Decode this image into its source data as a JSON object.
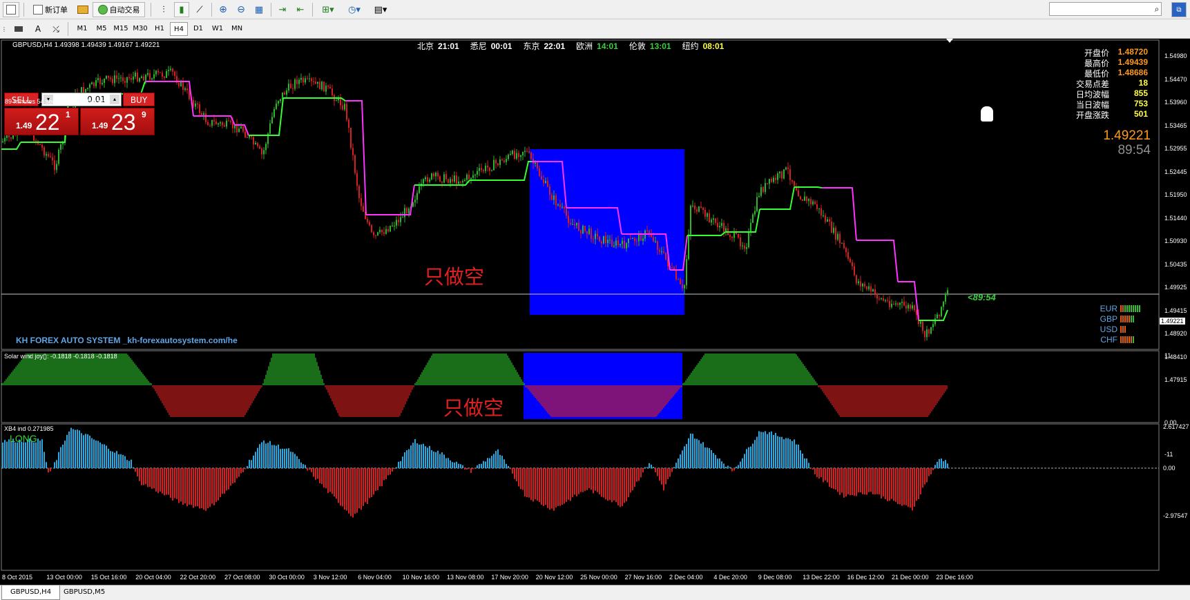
{
  "toolbar": {
    "new_order_label": "新订单",
    "auto_trading_label": "自动交易"
  },
  "timeframes": [
    "M1",
    "M5",
    "M15",
    "M30",
    "H1",
    "H4",
    "D1",
    "W1",
    "MN"
  ],
  "active_timeframe": "H4",
  "chart": {
    "header_text": "GBPUSD,H4  1.49398 1.49439 1.49167 1.49221",
    "sessions": [
      {
        "city": "北京",
        "time": "21:01",
        "color": "#ffffff"
      },
      {
        "city": "悉尼",
        "time": "00:01",
        "color": "#ffffff"
      },
      {
        "city": "东京",
        "time": "22:01",
        "color": "#ffffff"
      },
      {
        "city": "欧洲",
        "time": "14:01",
        "color": "#3ad23a"
      },
      {
        "city": "伦敦",
        "time": "13:01",
        "color": "#3ad23a"
      },
      {
        "city": "纽约",
        "time": "08:01",
        "color": "#ffff40"
      }
    ],
    "trade_panel": {
      "sell_label": "SELL",
      "buy_label": "BUY",
      "lot": "0.01",
      "sell_prefix": "1.49",
      "sell_big": "22",
      "sell_sup": "1",
      "buy_prefix": "1.49",
      "buy_big": "23",
      "buy_sup": "9",
      "bar_end_text": "89 minutes 54 seconds left to bar end"
    },
    "stats": [
      {
        "label": "开盘价",
        "value": "1.48720",
        "color": "#ff9a1a"
      },
      {
        "label": "最高价",
        "value": "1.49439",
        "color": "#ff9a1a"
      },
      {
        "label": "最低价",
        "value": "1.48686",
        "color": "#ff9a1a"
      },
      {
        "label": "交易点差",
        "value": "18",
        "color": "#ffff40"
      },
      {
        "label": "日均波幅",
        "value": "855",
        "color": "#ffff40"
      },
      {
        "label": "当日波幅",
        "value": "753",
        "color": "#ffff40"
      },
      {
        "label": "开盘涨跌",
        "value": "501",
        "color": "#ffff40"
      }
    ],
    "big_price": "1.49221",
    "big_timer": "89:54",
    "countdown_label": "<89:54",
    "annotation_main": "只做空",
    "annotation_sub": "只做空",
    "brand_text": "KH FOREX AUTO SYSTEM _kh-forexautosystem.com/he",
    "currencies": [
      {
        "name": "EUR",
        "green": 8,
        "red": 2
      },
      {
        "name": "GBP",
        "green": 2,
        "red": 5
      },
      {
        "name": "USD",
        "green": 0,
        "red": 3
      },
      {
        "name": "CHF",
        "green": 1,
        "red": 6
      }
    ],
    "price_axis": [
      "1.54980",
      "1.54470",
      "1.53960",
      "1.53465",
      "1.52955",
      "1.52445",
      "1.51950",
      "1.51440",
      "1.50930",
      "1.50435",
      "1.49925",
      "1.49415",
      "1.48920",
      "1.48410",
      "1.47915"
    ],
    "current_price_tag": "1.49221",
    "indicator1_label": "Solar wind joy(): -0.1818 -0.1818 -0.1818",
    "indicator1_axis": [
      "11",
      "0.00",
      "-11"
    ],
    "indicator2_label": "XB4 ind 0.271985",
    "indicator2_signal": "LONG",
    "indicator2_axis": [
      "2.617427",
      "0.00",
      "-2.97547"
    ],
    "time_axis": [
      "8 Oct 2015",
      "13 Oct 00:00",
      "15 Oct 16:00",
      "20 Oct 04:00",
      "22 Oct 20:00",
      "27 Oct 08:00",
      "30 Oct 00:00",
      "3 Nov 12:00",
      "6 Nov 04:00",
      "10 Nov 16:00",
      "13 Nov 08:00",
      "17 Nov 20:00",
      "20 Nov 12:00",
      "25 Nov 00:00",
      "27 Nov 16:00",
      "2 Dec 04:00",
      "4 Dec 20:00",
      "9 Dec 08:00",
      "13 Dec 22:00",
      "16 Dec 12:00",
      "21 Dec 00:00",
      "23 Dec 16:00"
    ]
  },
  "bottom_tabs": [
    "GBPUSD,H4",
    "GBPUSD,M5"
  ],
  "colors": {
    "bull": "#2bb82b",
    "bear": "#d32020",
    "highlight": "#0000ff",
    "line_up": "#33ff33",
    "line_down": "#ff33ff",
    "osc_up": "#2aa8e0",
    "text_red": "#e02020"
  }
}
